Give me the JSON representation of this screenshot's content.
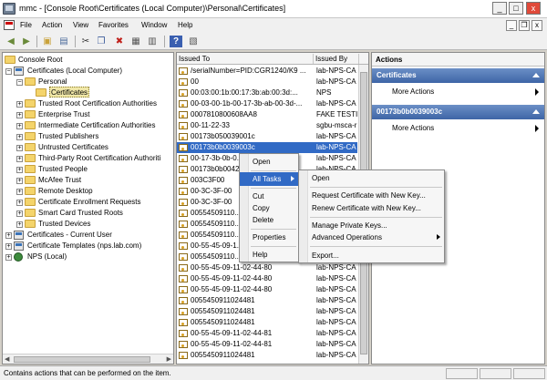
{
  "window": {
    "title": "mmc - [Console Root\\Certificates (Local Computer)\\Personal\\Certificates]",
    "minimize": "_",
    "maximize": "□",
    "close": "x"
  },
  "menubar": {
    "items": [
      "File",
      "Action",
      "View",
      "Favorites",
      "Window",
      "Help"
    ],
    "mdi_min": "_",
    "mdi_restore": "❐",
    "mdi_close": "x"
  },
  "toolbar": {
    "icons": [
      "back-arrow-icon",
      "forward-arrow-icon",
      "up-folder-icon",
      "show-tree-icon",
      "cut-icon",
      "copy-icon",
      "delete-icon",
      "properties-icon",
      "export-list-icon",
      "help-icon",
      "show-action-pane-icon"
    ]
  },
  "tree": {
    "items": [
      {
        "label": "Console Root",
        "icon": "folder"
      },
      {
        "label": "Certificates (Local Computer)",
        "icon": "cert",
        "expander": "−"
      },
      {
        "label": "Personal",
        "icon": "folder",
        "expander": "−"
      },
      {
        "label": "Certificates",
        "icon": "folder",
        "selected": true
      },
      {
        "label": "Trusted Root Certification Authorities",
        "icon": "folder",
        "expander": "+"
      },
      {
        "label": "Enterprise Trust",
        "icon": "folder",
        "expander": "+"
      },
      {
        "label": "Intermediate Certification Authorities",
        "icon": "folder",
        "expander": "+"
      },
      {
        "label": "Trusted Publishers",
        "icon": "folder",
        "expander": "+"
      },
      {
        "label": "Untrusted Certificates",
        "icon": "folder",
        "expander": "+"
      },
      {
        "label": "Third-Party Root Certification Authoriti",
        "icon": "folder",
        "expander": "+"
      },
      {
        "label": "Trusted People",
        "icon": "folder",
        "expander": "+"
      },
      {
        "label": "McAfee Trust",
        "icon": "folder",
        "expander": "+"
      },
      {
        "label": "Remote Desktop",
        "icon": "folder",
        "expander": "+"
      },
      {
        "label": "Certificate Enrollment Requests",
        "icon": "folder",
        "expander": "+"
      },
      {
        "label": "Smart Card Trusted Roots",
        "icon": "folder",
        "expander": "+"
      },
      {
        "label": "Trusted Devices",
        "icon": "folder",
        "expander": "+"
      },
      {
        "label": "Certificates - Current User",
        "icon": "cert",
        "expander": "+"
      },
      {
        "label": "Certificate Templates (nps.lab.com)",
        "icon": "cert",
        "expander": "+"
      },
      {
        "label": "NPS (Local)",
        "icon": "nps",
        "expander": "+"
      }
    ]
  },
  "list": {
    "columns": [
      "Issued To",
      "Issued By"
    ],
    "rows": [
      [
        "/serialNumber=PID:CGR1240/K9 ...",
        "lab-NPS-CA"
      ],
      [
        "00",
        "lab-NPS-CA"
      ],
      [
        "00:03:00:1b:00:17:3b:ab:00:3d:...",
        "NPS"
      ],
      [
        "00-03-00-1b-00-17-3b-ab-00-3d-...",
        "lab-NPS-CA"
      ],
      [
        "0007810800608AA8",
        "FAKE TESTIN"
      ],
      [
        "00-11-22-33",
        "sgbu-msca-r"
      ],
      [
        "00173b050039001c",
        "lab-NPS-CA"
      ],
      [
        "00173b0b0039003c",
        "lab-NPS-CA"
      ],
      [
        "00-17-3b-0b-0...",
        "lab-NPS-CA"
      ],
      [
        "00173b0b0042...",
        "lab-NPS-CA"
      ],
      [
        "003C3F00",
        ""
      ],
      [
        "00-3C-3F-00",
        ""
      ],
      [
        "00-3C-3F-00",
        ""
      ],
      [
        "00554509110...",
        ""
      ],
      [
        "00554509110...",
        ""
      ],
      [
        "00554509110...",
        ""
      ],
      [
        "00-55-45-09-1...",
        ""
      ],
      [
        "00554509110...",
        ""
      ],
      [
        "00-55-45-09-11-02-44-80",
        "lab-NPS-CA"
      ],
      [
        "00-55-45-09-11-02-44-80",
        "lab-NPS-CA"
      ],
      [
        "00-55-45-09-11-02-44-80",
        "lab-NPS-CA"
      ],
      [
        "0055450911024481",
        "lab-NPS-CA"
      ],
      [
        "0055450911024481",
        "lab-NPS-CA"
      ],
      [
        "0055450911024481",
        "lab-NPS-CA"
      ],
      [
        "00-55-45-09-11-02-44-81",
        "lab-NPS-CA"
      ],
      [
        "00-55-45-09-11-02-44-81",
        "lab-NPS-CA"
      ],
      [
        "0055450911024481",
        "lab-NPS-CA"
      ]
    ],
    "selected_row": 7
  },
  "actions": {
    "header": "Actions",
    "sections": [
      {
        "title": "Certificates",
        "item": "More Actions"
      },
      {
        "title": "00173b0b0039003c",
        "item": "More Actions"
      }
    ]
  },
  "context_menu": {
    "items": [
      "Open",
      "All Tasks",
      "Cut",
      "Copy",
      "Delete",
      "Properties",
      "Help"
    ],
    "highlighted": "All Tasks"
  },
  "submenu": {
    "items": [
      "Open",
      "Request Certificate with New Key...",
      "Renew Certificate with New Key...",
      "Manage Private Keys...",
      "Advanced Operations",
      "Export..."
    ]
  },
  "status": {
    "text": "Contains actions that can be performed on the item."
  },
  "colors": {
    "selection": "#316ac5",
    "actions_header": "#3e65a6",
    "folder": "#f4d46b"
  }
}
